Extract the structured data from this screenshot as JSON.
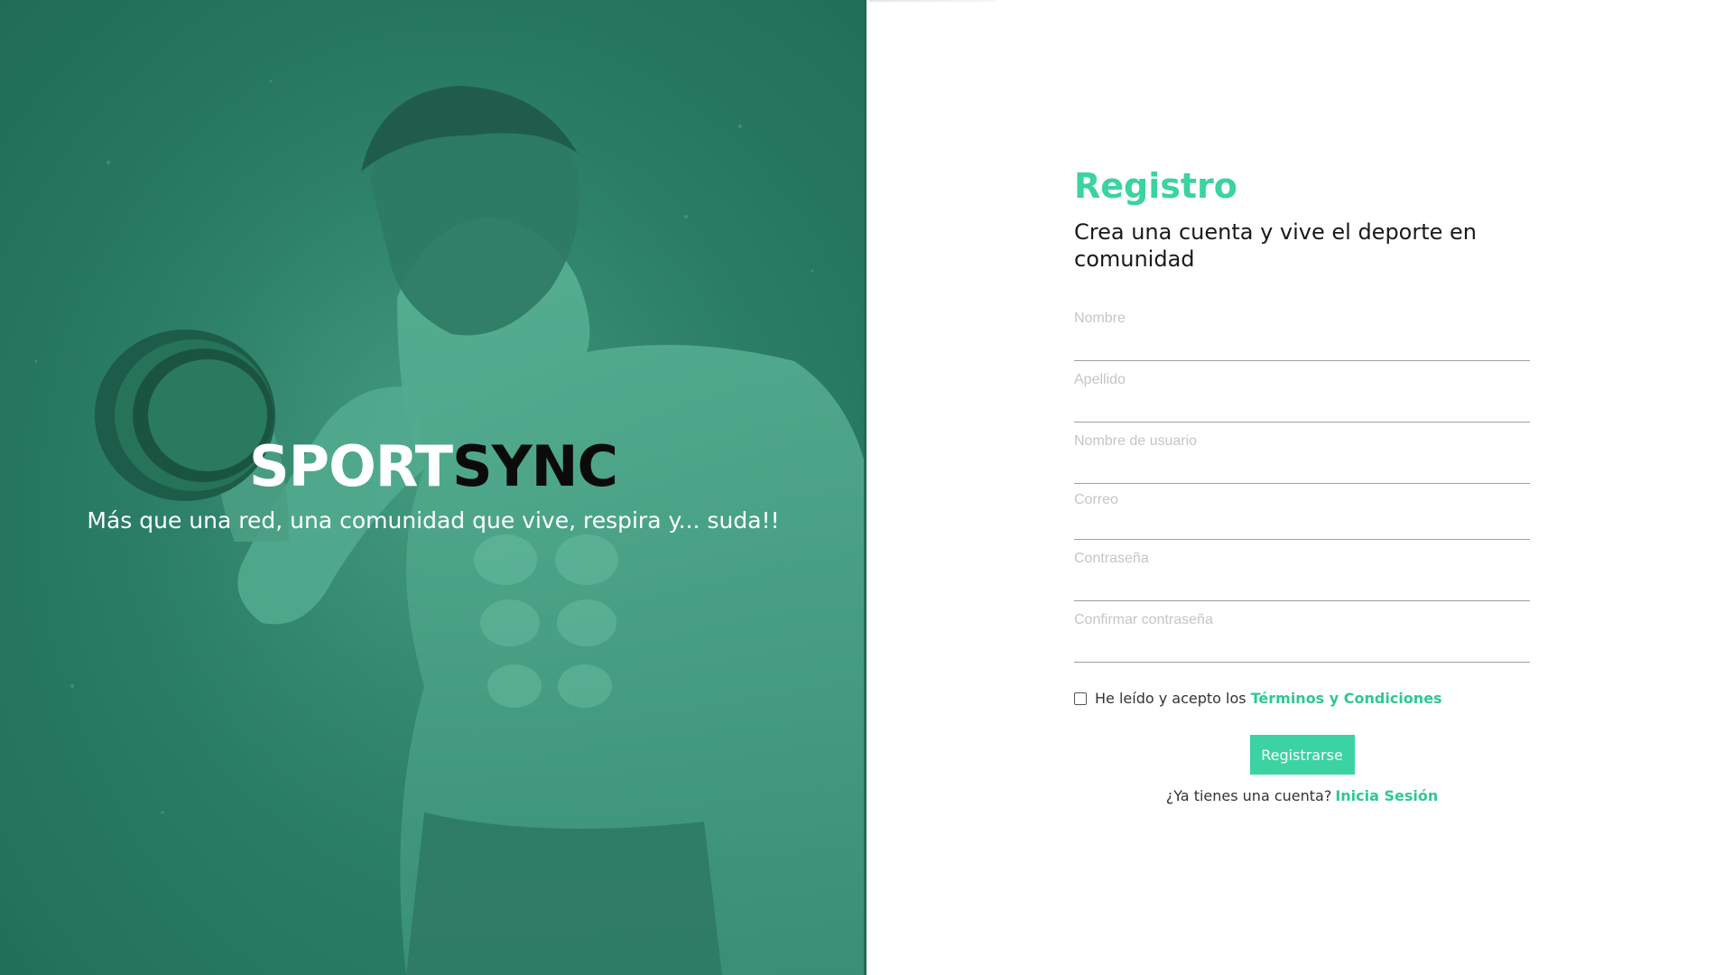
{
  "hero": {
    "brand_part1": "SPORT",
    "brand_part2": "SYNC",
    "tagline": "Más que una red, una comunidad que vive, respira y... suda!!"
  },
  "form": {
    "title": "Registro",
    "subtitle": "Crea una cuenta y vive el deporte en comunidad",
    "fields": {
      "nombre": {
        "placeholder": "Nombre",
        "value": ""
      },
      "apellido": {
        "placeholder": "Apellido",
        "value": ""
      },
      "usuario": {
        "placeholder": "Nombre de usuario",
        "value": ""
      },
      "correo": {
        "placeholder": "Correo",
        "value": ""
      },
      "contrasena": {
        "placeholder": "Contraseña",
        "value": ""
      },
      "confirmar": {
        "placeholder": "Confirmar contraseña",
        "value": ""
      }
    },
    "terms_text": "He leído y acepto los",
    "terms_link": "Términos y Condiciones",
    "terms_checked": false,
    "submit_label": "Registrarse",
    "login_text": "¿Ya tienes una cuenta?",
    "login_link": "Inicia Sesión"
  },
  "colors": {
    "accent": "#3ad3a1",
    "hero_overlay": "#2a7f66",
    "text": "#1a1a1a"
  }
}
